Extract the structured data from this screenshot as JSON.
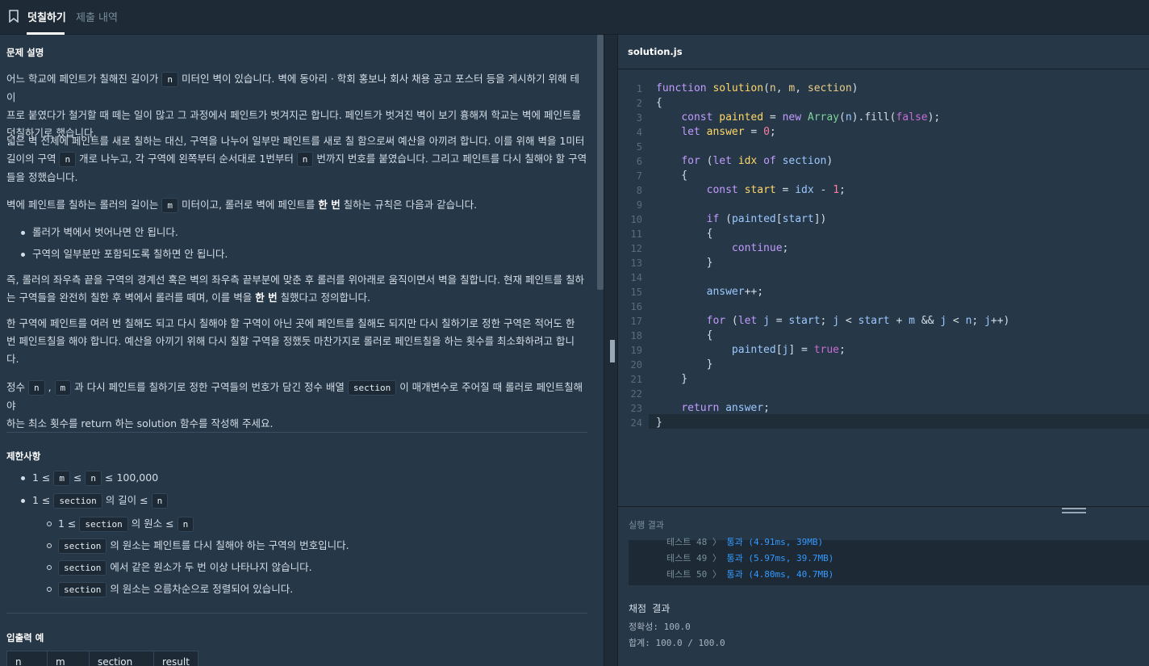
{
  "tabs": [
    {
      "label": "덧칠하기"
    },
    {
      "label": "제출 내역"
    }
  ],
  "problem": {
    "heading": "문제 설명",
    "para1": {
      "a": "어느 학교에 페인트가 칠해진 길이가 ",
      "code1": "n",
      "b": " 미터인 벽이 있습니다. 벽에 동아리 · 학회 홍보나 회사 채용 공고 포스터 등을 게시하기 위해 테이",
      "line2": "프로 붙였다가 철거할 때 떼는 일이 많고 그 과정에서 페인트가 벗겨지곤 합니다. 페인트가 벗겨진 벽이 보기 흉해져 학교는 벽에 페인트를",
      "line3": "덧칠하기로 했습니다."
    },
    "para2": {
      "line1": "넓은 벽 전체에 페인트를 새로 칠하는 대신, 구역을 나누어 일부만 페인트를 새로 칠 함으로써 예산을 아끼려 합니다. 이를 위해 벽을 1미터",
      "a": "길이의 구역 ",
      "code1": "n",
      "b": " 개로 나누고, 각 구역에 왼쪽부터 순서대로 1번부터 ",
      "code2": "n",
      "c": " 번까지 번호를 붙였습니다. 그리고 페인트를 다시 칠해야 할 구역",
      "line3": "들을 정했습니다."
    },
    "para3": {
      "a": "벽에 페인트를 칠하는 롤러의 길이는 ",
      "code1": "m",
      "b": " 미터이고, 롤러로 벽에 페인트를 ",
      "bold": "한 번",
      "c": " 칠하는 규칙은 다음과 같습니다."
    },
    "rules": [
      "롤러가 벽에서 벗어나면 안 됩니다.",
      "구역의 일부분만 포함되도록 칠하면 안 됩니다."
    ],
    "para4": {
      "line1": "즉, 롤러의 좌우측 끝을 구역의 경계선 혹은 벽의 좌우측 끝부분에 맞춘 후 롤러를 위아래로 움직이면서 벽을 칠합니다. 현재 페인트를 칠하",
      "a": "는 구역들을 완전히 칠한 후 벽에서 롤러를 떼며, 이를 벽을 ",
      "bold": "한 번",
      "b": " 칠했다고 정의합니다."
    },
    "para5": {
      "line1": "한 구역에 페인트를 여러 번 칠해도 되고 다시 칠해야 할 구역이 아닌 곳에 페인트를 칠해도 되지만 다시 칠하기로 정한 구역은 적어도 한",
      "line2": "번 페인트칠을 해야 합니다. 예산을 아끼기 위해 다시 칠할 구역을 정했듯 마찬가지로 롤러로 페인트칠을 하는 횟수를 최소화하려고 합니",
      "line3": "다."
    },
    "para6": {
      "a": "정수 ",
      "code1": "n",
      "sep": " , ",
      "code2": "m",
      "b": " 과 다시 페인트를 칠하기로 정한 구역들의 번호가 담긴 정수 배열 ",
      "code3": "section",
      "c": " 이 매개변수로 주어질 때 롤러로 페인트칠해야",
      "line2": "하는 최소 횟수를 return 하는 solution 함수를 작성해 주세요."
    }
  },
  "constraints": {
    "heading": "제한사항",
    "c1": {
      "a": "1 ≤ ",
      "code1": "m",
      "b": " ≤ ",
      "code2": "n",
      "c": " ≤ 100,000"
    },
    "c2": {
      "a": "1 ≤ ",
      "code1": "section",
      "b": " 의 길이 ≤ ",
      "code2": "n"
    },
    "s1": {
      "a": "1 ≤ ",
      "code1": "section",
      "b": " 의 원소 ≤ ",
      "code2": "n"
    },
    "s2": {
      "code1": "section",
      "b": " 의 원소는 페인트를 다시 칠해야 하는 구역의 번호입니다."
    },
    "s3": {
      "code1": "section",
      "b": " 에서 같은 원소가 두 번 이상 나타나지 않습니다."
    },
    "s4": {
      "code1": "section",
      "b": " 의 원소는 오름차순으로 정렬되어 있습니다."
    }
  },
  "io": {
    "heading": "입출력 예",
    "columns": [
      "n",
      "m",
      "section",
      "result"
    ]
  },
  "editor": {
    "file_name": "solution.js",
    "line_numbers": [
      "1",
      "2",
      "3",
      "4",
      "5",
      "6",
      "7",
      "8",
      "9",
      "10",
      "11",
      "12",
      "13",
      "14",
      "15",
      "16",
      "17",
      "18",
      "19",
      "20",
      "21",
      "22",
      "23",
      "24"
    ]
  },
  "results": {
    "title": "실행 결과",
    "rows": [
      {
        "label": "테스트 48 〉",
        "value": "통과 (4.91ms, 39MB)"
      },
      {
        "label": "테스트 49 〉",
        "value": "통과 (5.97ms, 39.7MB)"
      },
      {
        "label": "테스트 50 〉",
        "value": "통과 (4.80ms, 40.7MB)"
      }
    ],
    "grade_title": "채점 결과",
    "accuracy": "정확성: 100.0",
    "total": "합계: 100.0 / 100.0"
  },
  "colors": {
    "background": "#263747",
    "accent": "#3399ff",
    "topbar": "#1e2a36"
  }
}
